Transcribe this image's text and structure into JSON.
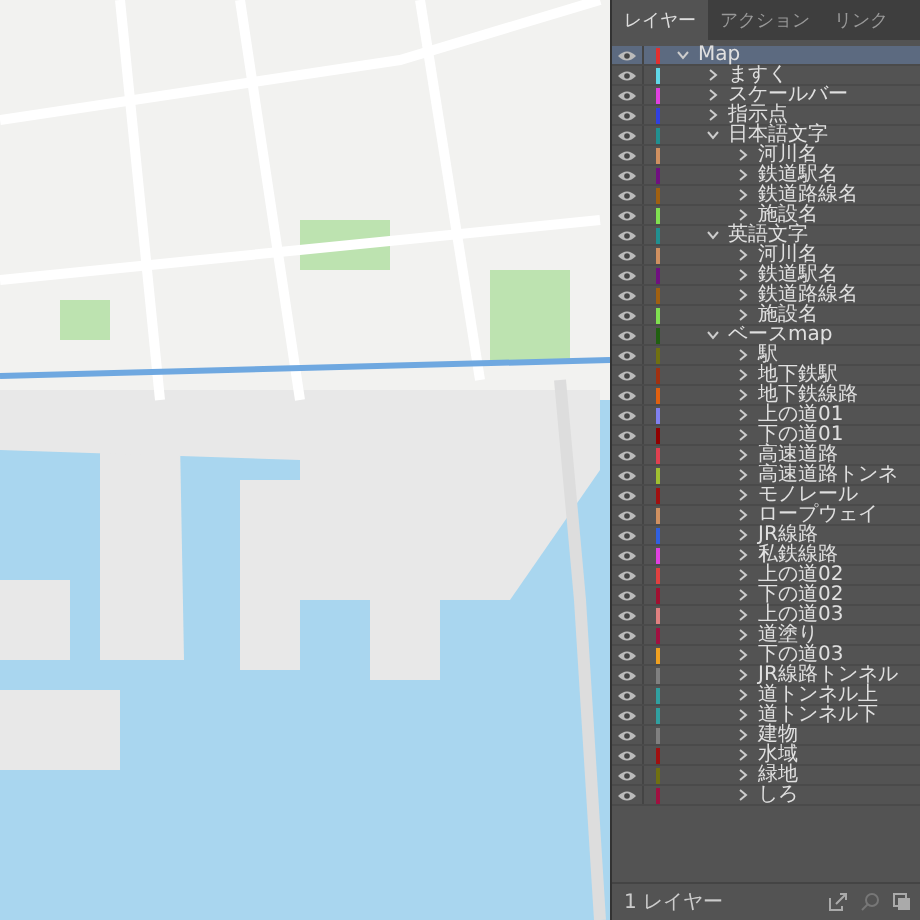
{
  "panel": {
    "tabs": [
      {
        "label": "レイヤー",
        "selected": true
      },
      {
        "label": "アクション",
        "selected": false
      },
      {
        "label": "リンク",
        "selected": false
      }
    ],
    "layers": [
      {
        "name": "Map",
        "color": "#e03030",
        "expanded": true,
        "selected": true,
        "children": [
          {
            "name": "ますく",
            "color": "#60d8e8",
            "expanded": false,
            "selected": false
          },
          {
            "name": "スケールバー",
            "color": "#e040e0",
            "expanded": false,
            "selected": false
          },
          {
            "name": "指示点",
            "color": "#3040e0",
            "expanded": false,
            "selected": false
          },
          {
            "name": "日本語文字",
            "color": "#209090",
            "expanded": true,
            "selected": false,
            "children": [
              {
                "name": "河川名",
                "color": "#d09060",
                "expanded": false,
                "selected": false
              },
              {
                "name": "鉄道駅名",
                "color": "#701080",
                "expanded": false,
                "selected": false
              },
              {
                "name": "鉄道路線名",
                "color": "#a06010",
                "expanded": false,
                "selected": false
              },
              {
                "name": "施設名",
                "color": "#80e050",
                "expanded": false,
                "selected": false
              }
            ]
          },
          {
            "name": "英語文字",
            "color": "#209090",
            "expanded": true,
            "selected": false,
            "children": [
              {
                "name": "河川名",
                "color": "#d09060",
                "expanded": false,
                "selected": false
              },
              {
                "name": "鉄道駅名",
                "color": "#701080",
                "expanded": false,
                "selected": false
              },
              {
                "name": "鉄道路線名",
                "color": "#a06010",
                "expanded": false,
                "selected": false
              },
              {
                "name": "施設名",
                "color": "#80e050",
                "expanded": false,
                "selected": false
              }
            ]
          },
          {
            "name": "ベースmap",
            "color": "#206010",
            "expanded": true,
            "selected": false,
            "children": [
              {
                "name": "駅",
                "color": "#707010",
                "expanded": false,
                "selected": false
              },
              {
                "name": "地下鉄駅",
                "color": "#a03010",
                "expanded": false,
                "selected": false
              },
              {
                "name": "地下鉄線路",
                "color": "#e06010",
                "expanded": false,
                "selected": false
              },
              {
                "name": "上の道01",
                "color": "#8080f0",
                "expanded": false,
                "selected": false
              },
              {
                "name": "下の道01",
                "color": "#900000",
                "expanded": false,
                "selected": false
              },
              {
                "name": "高速道路",
                "color": "#e04050",
                "expanded": false,
                "selected": false
              },
              {
                "name": "高速道路トンネ",
                "color": "#a0c030",
                "expanded": false,
                "selected": false
              },
              {
                "name": "モノレール",
                "color": "#a01010",
                "expanded": false,
                "selected": false
              },
              {
                "name": "ロープウェイ",
                "color": "#d09060",
                "expanded": false,
                "selected": false
              },
              {
                "name": "JR線路",
                "color": "#3060e0",
                "expanded": false,
                "selected": false
              },
              {
                "name": "私鉄線路",
                "color": "#e040e0",
                "expanded": false,
                "selected": false
              },
              {
                "name": "上の道02",
                "color": "#e04040",
                "expanded": false,
                "selected": false
              },
              {
                "name": "下の道02",
                "color": "#a01030",
                "expanded": false,
                "selected": false
              },
              {
                "name": "上の道03",
                "color": "#e08080",
                "expanded": false,
                "selected": false
              },
              {
                "name": "道塗り",
                "color": "#a01040",
                "expanded": false,
                "selected": false
              },
              {
                "name": "下の道03",
                "color": "#f0a020",
                "expanded": false,
                "selected": false
              },
              {
                "name": "JR線路トンネル",
                "color": "#808080",
                "expanded": false,
                "selected": false
              },
              {
                "name": "道トンネル上",
                "color": "#30a0a0",
                "expanded": false,
                "selected": false
              },
              {
                "name": "道トンネル下",
                "color": "#30a0a0",
                "expanded": false,
                "selected": false
              },
              {
                "name": "建物",
                "color": "#808080",
                "expanded": false,
                "selected": false
              },
              {
                "name": "水域",
                "color": "#a01010",
                "expanded": false,
                "selected": false
              },
              {
                "name": "緑地",
                "color": "#707010",
                "expanded": false,
                "selected": false
              },
              {
                "name": "しろ",
                "color": "#a01040",
                "expanded": false,
                "selected": false
              }
            ]
          }
        ]
      }
    ],
    "footer": {
      "count": "1 レイヤー"
    }
  }
}
